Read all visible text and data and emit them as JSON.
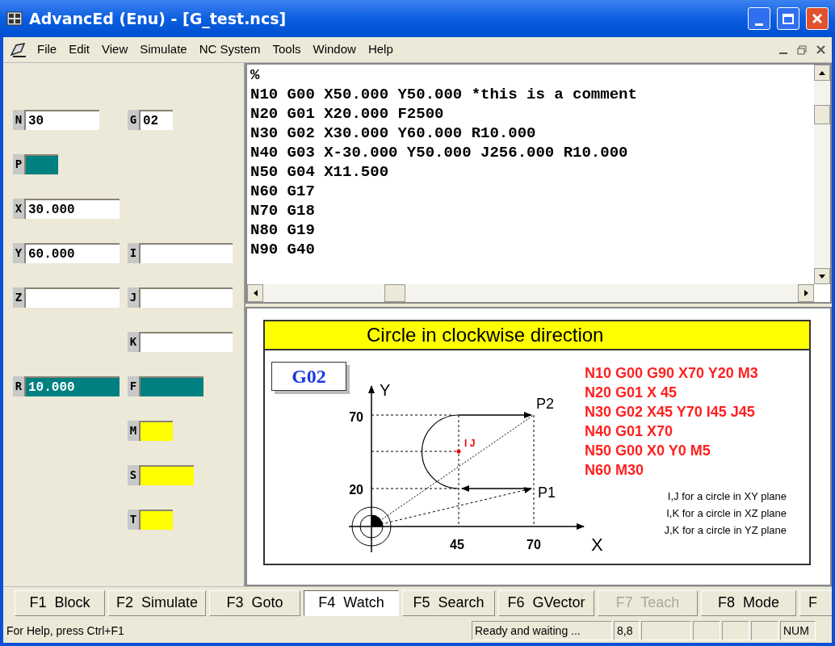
{
  "window": {
    "title": "AdvancEd (Enu) - [G_test.ncs]"
  },
  "menu": [
    "File",
    "Edit",
    "View",
    "Simulate",
    "NC System",
    "Tools",
    "Window",
    "Help"
  ],
  "fields": [
    {
      "left": {
        "label": "N",
        "value": "30",
        "color": "#ffffff"
      },
      "right": {
        "label": "G",
        "value": "02",
        "color": "#ffffff"
      }
    },
    {
      "left": {
        "label": "P",
        "color": "#008080"
      }
    },
    {
      "left": {
        "label": "X",
        "value": "30.000",
        "color": "#ffffff"
      }
    },
    {
      "left": {
        "label": "Y",
        "value": "60.000",
        "color": "#ffffff"
      },
      "right": {
        "label": "I",
        "color": "#ffffff"
      }
    },
    {
      "left": {
        "label": "Z",
        "color": "#ffffff"
      },
      "right": {
        "label": "J",
        "color": "#ffffff"
      }
    },
    {
      "right": {
        "label": "K",
        "color": "#ffffff"
      }
    },
    {
      "left": {
        "label": "R",
        "value": "10.000",
        "color": "#008080"
      },
      "right": {
        "label": "F",
        "color": "#008080"
      }
    },
    {
      "right": {
        "label": "M",
        "color": "#ffff00"
      }
    },
    {
      "right": {
        "label": "S",
        "color": "#ffff00"
      }
    },
    {
      "right": {
        "label": "T",
        "color": "#ffff00"
      }
    }
  ],
  "code_lines": [
    "%",
    "N10 G00 X50.000 Y50.000 *this is a comment",
    "N20 G01 X20.000 F2500",
    "N30 G02 X30.000 Y60.000 R10.000",
    "N40 G03 X-30.000 Y50.000 J256.000 R10.000",
    "N50 G04 X11.500",
    "N60 G17",
    "N70 G18",
    "N80 G19",
    "N90 G40"
  ],
  "help_panel": {
    "title": "Circle in clockwise direction",
    "code": "G02",
    "diagram": {
      "y_axis": "Y",
      "x_axis": "X",
      "y_ticks": [
        "70",
        "20"
      ],
      "x_ticks": [
        "45",
        "70"
      ],
      "p2": "P2",
      "p1": "P1",
      "center": "I J"
    },
    "program": [
      "N10 G00 G90 X70 Y20 M3",
      "N20 G01 X 45",
      "N30 G02 X45 Y70 I45 J45",
      "N40 G01 X70",
      "N50 G00 X0 Y0 M5",
      "N60 M30"
    ],
    "notes": [
      "I,J for a circle in XY plane",
      "I,K for a circle in XZ plane",
      "J,K for a circle in YZ plane"
    ]
  },
  "function_keys": [
    {
      "key": "F1",
      "label": "Block",
      "selected": false,
      "disabled": false
    },
    {
      "key": "F2",
      "label": "Simulate",
      "selected": false,
      "disabled": false
    },
    {
      "key": "F3",
      "label": "Goto",
      "selected": false,
      "disabled": false
    },
    {
      "key": "F4",
      "label": "Watch",
      "selected": true,
      "disabled": false
    },
    {
      "key": "F5",
      "label": "Search",
      "selected": false,
      "disabled": false
    },
    {
      "key": "F6",
      "label": "GVector",
      "selected": false,
      "disabled": false
    },
    {
      "key": "F7",
      "label": "Teach",
      "selected": false,
      "disabled": true
    },
    {
      "key": "F8",
      "label": "Mode",
      "selected": false,
      "disabled": false
    },
    {
      "key": "F"
    }
  ],
  "status_bar": {
    "help": "For Help, press Ctrl+F1",
    "panes": [
      "Ready and waiting ...",
      "8,8",
      "NUM"
    ]
  }
}
